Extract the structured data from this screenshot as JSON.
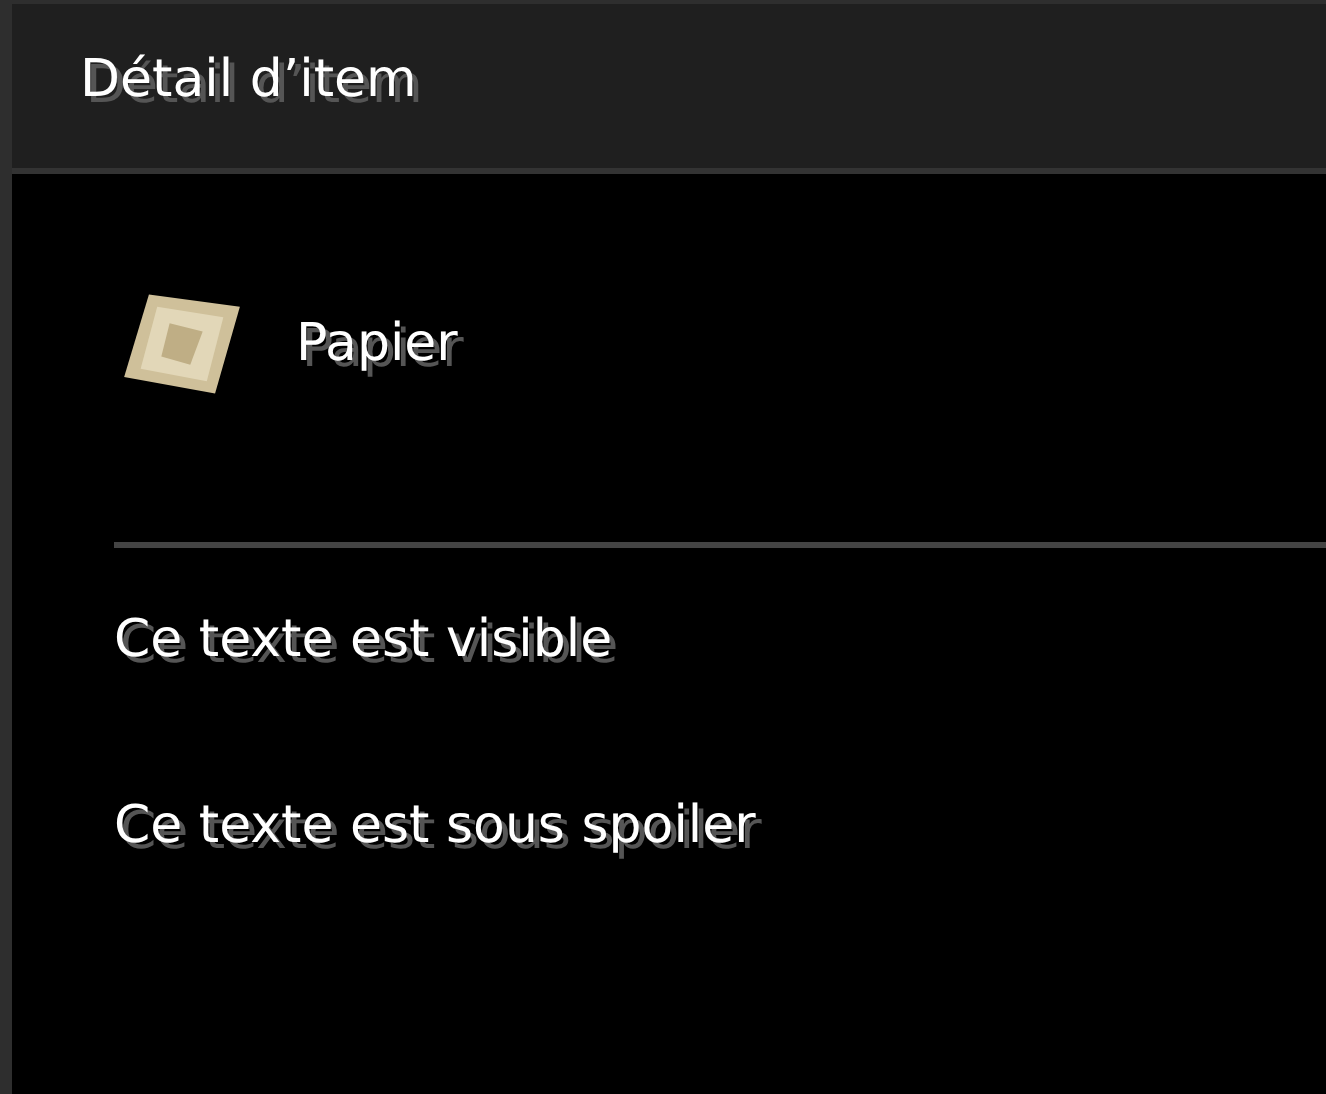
{
  "window": {
    "title": "Détail d’item"
  },
  "item": {
    "name": "Papier"
  },
  "lines": [
    "Ce texte est visible",
    "Ce texte est sous spoiler"
  ]
}
